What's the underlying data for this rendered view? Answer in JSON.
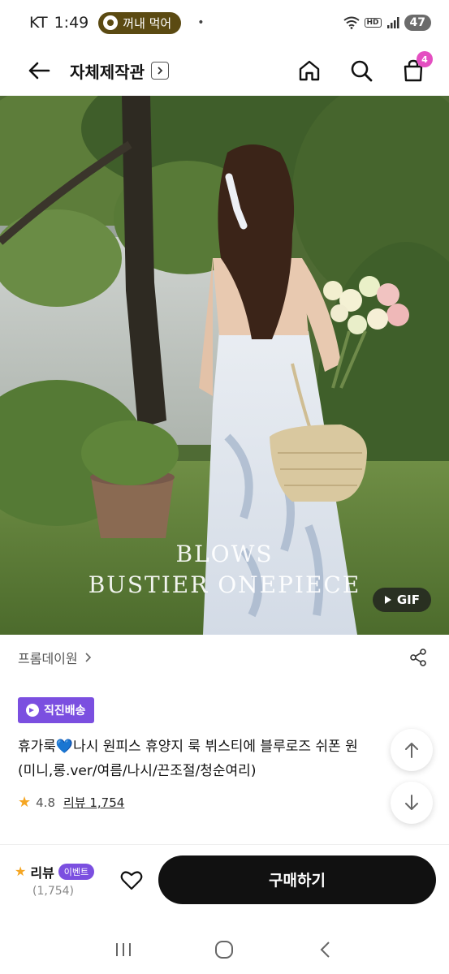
{
  "status_bar": {
    "carrier": "KT",
    "time": "1:49",
    "pill_label": "꺼내 먹어",
    "dot": "•",
    "battery": "47",
    "hd": "HD"
  },
  "nav": {
    "title": "자체제작관",
    "cart_count": "4",
    "icons": [
      "back-arrow-icon",
      "home-icon",
      "search-icon",
      "cart-icon"
    ]
  },
  "hero": {
    "line1": "BLOWS",
    "line2": "BUSTIER ONEPIECE",
    "gif_label": "GIF"
  },
  "brand": {
    "name": "프롬데이원"
  },
  "product": {
    "shipping_badge": "직진배송",
    "title_line1_a": "휴가룩",
    "title_line1_heart": "💙",
    "title_line1_b": "나시 원피스 휴양지 룩 뷔스티에 블루로즈 쉬폰 원",
    "title_line2": "(미니,롱.ver/여름/나시/끈조절/청순여리)",
    "rating": "4.8",
    "review_label": "리뷰 1,754"
  },
  "action_bar": {
    "review_label": "리뷰",
    "event_label": "이벤트",
    "review_count": "(1,754)",
    "buy_label": "구매하기"
  },
  "colors": {
    "accent": "#7b4fe0",
    "cart_badge": "#e44fc1",
    "buy_button": "#111111",
    "star": "#f5a623"
  }
}
